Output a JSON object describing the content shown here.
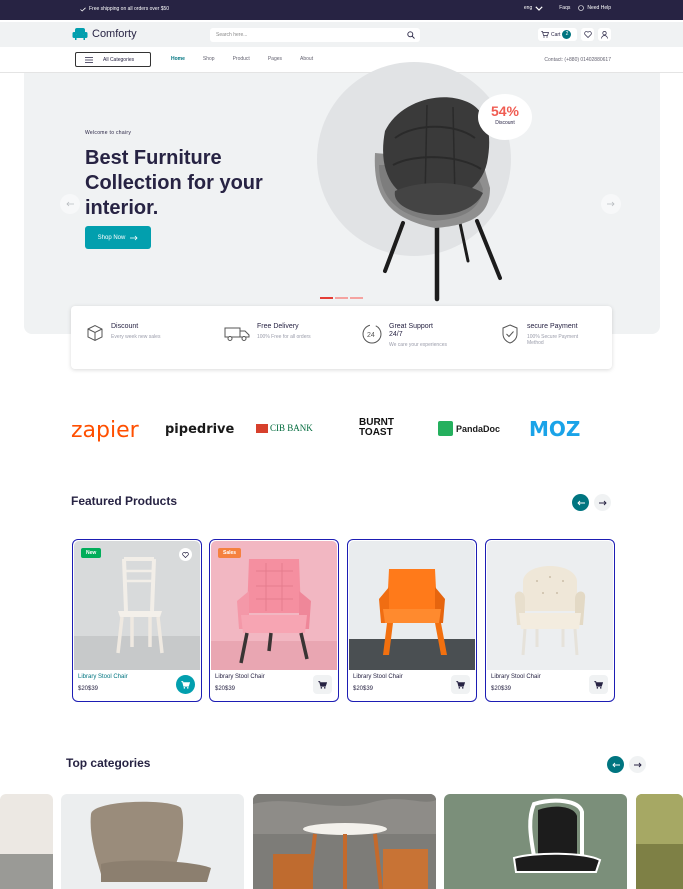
{
  "topbar": {
    "shipping": "Free shipping on all orders over $50",
    "language": "eng",
    "faqs": "Faqs",
    "help": "Need Help"
  },
  "header": {
    "brand": "Comforty",
    "search_placeholder": "Search here...",
    "cart_label": "Cart",
    "cart_count": "2"
  },
  "nav": {
    "all_categories": "All Categories",
    "links": [
      "Home",
      "Shop",
      "Product",
      "Pages",
      "About"
    ],
    "contact": "Contact: (+880) 01402880617"
  },
  "hero": {
    "eyebrow": "Welcome to chairy",
    "title": "Best Furniture Collection for your interior.",
    "button": "Shop Now",
    "discount_pct": "54%",
    "discount_label": "Discount"
  },
  "features": [
    {
      "title": "Discount",
      "desc": "Every week new sales",
      "icon": "box-icon"
    },
    {
      "title": "Free Delivery",
      "desc": "100% Free for all orders",
      "icon": "truck-icon"
    },
    {
      "title": "Great Support 24/7",
      "desc": "We care your experiences",
      "icon": "support-icon"
    },
    {
      "title": "secure Payment",
      "desc": "100% Secure Payment Method",
      "icon": "shield-icon"
    }
  ],
  "brands": [
    "zapier",
    "pipedrive",
    "CIB BANK",
    "BURNT TOAST",
    "PandaDoc",
    "MOZ"
  ],
  "featured": {
    "title": "Featured Products",
    "products": [
      {
        "name": "Library Stool Chair",
        "price": "$20$39",
        "tag": "New"
      },
      {
        "name": "Library Stool Chair",
        "price": "$20$39",
        "tag": "Sales"
      },
      {
        "name": "Library Stool Chair",
        "price": "$20$39",
        "tag": ""
      },
      {
        "name": "Library Stool Chair",
        "price": "$20$39",
        "tag": ""
      }
    ]
  },
  "categories": {
    "title": "Top categories"
  },
  "colors": {
    "primary": "#029fae",
    "dark_teal": "#007580",
    "navy": "#272343",
    "sale": "#f5813f",
    "new": "#01ad5a"
  }
}
